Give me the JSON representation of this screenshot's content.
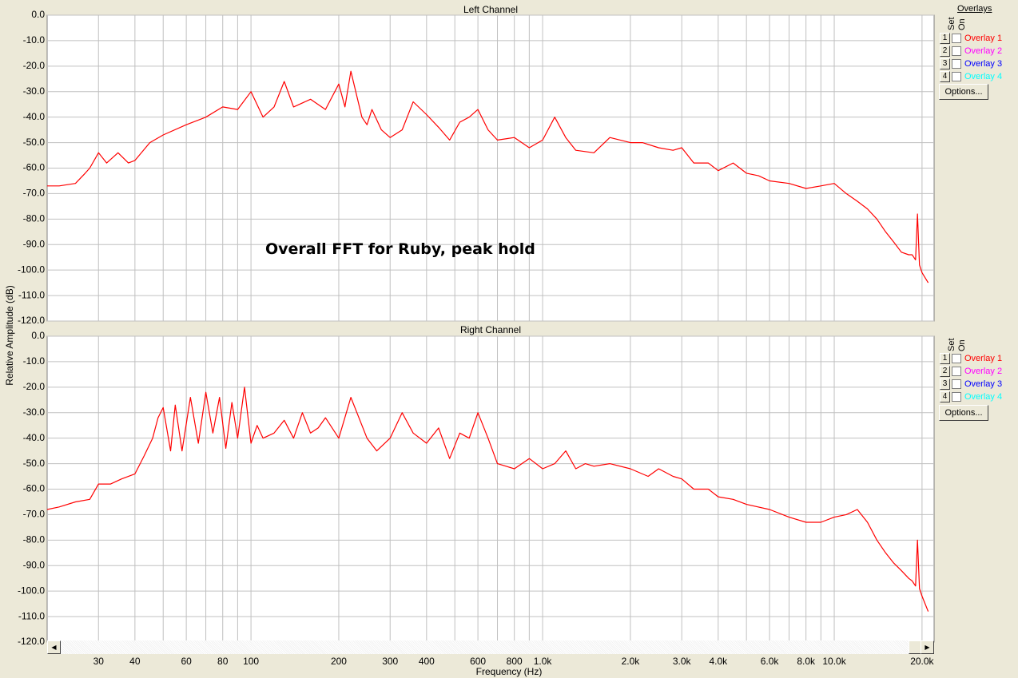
{
  "window": {
    "background": "#ECE9D8"
  },
  "annotation": "Overall FFT for Ruby, peak hold",
  "x_axis_label": "Frequency (Hz)",
  "y_axis_label": "Relative Amplitude (dB)",
  "overlays_panel": {
    "title": "Overlays",
    "set_header": "Set",
    "on_header": "On",
    "options_label": "Options...",
    "items": [
      {
        "set": "1",
        "label": "Overlay 1",
        "color": "#FF0000",
        "checked": false
      },
      {
        "set": "2",
        "label": "Overlay 2",
        "color": "#FF00FF",
        "checked": false
      },
      {
        "set": "3",
        "label": "Overlay 3",
        "color": "#0000FF",
        "checked": false
      },
      {
        "set": "4",
        "label": "Overlay 4",
        "color": "#00FFFF",
        "checked": false
      }
    ]
  },
  "chart_data": [
    {
      "type": "line",
      "title": "Left Channel",
      "xlabel": "",
      "ylabel": "",
      "x_scale": "log",
      "xlim": [
        20,
        22000
      ],
      "ylim": [
        -120,
        0
      ],
      "y_ticks": [
        "0.0",
        "-10.0",
        "-20.0",
        "-30.0",
        "-40.0",
        "-50.0",
        "-60.0",
        "-70.0",
        "-80.0",
        "-90.0",
        "-100.0",
        "-110.0",
        "-120.0"
      ],
      "grid": true,
      "line_color": "#FF0000",
      "series": [
        {
          "x": [
            20,
            22,
            25,
            27,
            28,
            30,
            32,
            35,
            38,
            40,
            45,
            50,
            60,
            70,
            80,
            90,
            100,
            110,
            120,
            130,
            140,
            160,
            180,
            200,
            210,
            220,
            240,
            250,
            260,
            280,
            300,
            330,
            360,
            400,
            440,
            480,
            520,
            560,
            600,
            650,
            700,
            800,
            900,
            1000,
            1100,
            1200,
            1300,
            1500,
            1700,
            2000,
            2200,
            2500,
            2800,
            3000,
            3300,
            3700,
            4000,
            4500,
            5000,
            5500,
            6000,
            7000,
            8000,
            9000,
            10000,
            11000,
            12000,
            13000,
            14000,
            15000,
            16000,
            17000,
            18000,
            18500,
            19000,
            19300,
            19600,
            20000,
            21000
          ],
          "y": [
            -67,
            -67,
            -66,
            -62,
            -60,
            -54,
            -58,
            -54,
            -58,
            -57,
            -50,
            -47,
            -43,
            -40,
            -36,
            -37,
            -30,
            -40,
            -36,
            -26,
            -36,
            -33,
            -37,
            -27,
            -36,
            -22,
            -40,
            -43,
            -37,
            -45,
            -48,
            -45,
            -34,
            -39,
            -44,
            -49,
            -42,
            -40,
            -37,
            -45,
            -49,
            -48,
            -52,
            -49,
            -40,
            -48,
            -53,
            -54,
            -48,
            -50,
            -50,
            -52,
            -53,
            -52,
            -58,
            -58,
            -61,
            -58,
            -62,
            -63,
            -65,
            -66,
            -68,
            -67,
            -66,
            -70,
            -73,
            -76,
            -80,
            -85,
            -89,
            -93,
            -94,
            -94,
            -96,
            -78,
            -98,
            -101,
            -105
          ]
        }
      ]
    },
    {
      "type": "line",
      "title": "Right Channel",
      "xlabel": "",
      "ylabel": "",
      "x_scale": "log",
      "xlim": [
        20,
        22000
      ],
      "ylim": [
        -120,
        0
      ],
      "y_ticks": [
        "0.0",
        "-10.0",
        "-20.0",
        "-30.0",
        "-40.0",
        "-50.0",
        "-60.0",
        "-70.0",
        "-80.0",
        "-90.0",
        "-100.0",
        "-110.0",
        "-120.0"
      ],
      "x_ticks": [
        "30",
        "40",
        "60",
        "80",
        "100",
        "200",
        "300",
        "400",
        "600",
        "800",
        "1.0k",
        "2.0k",
        "3.0k",
        "4.0k",
        "6.0k",
        "8.0k",
        "10.0k",
        "20.0k"
      ],
      "grid": true,
      "line_color": "#FF0000",
      "series": [
        {
          "x": [
            20,
            22,
            25,
            28,
            30,
            33,
            36,
            40,
            43,
            46,
            48,
            50,
            53,
            55,
            58,
            62,
            66,
            70,
            74,
            78,
            82,
            86,
            90,
            95,
            100,
            105,
            110,
            120,
            130,
            140,
            150,
            160,
            170,
            180,
            200,
            220,
            250,
            270,
            300,
            330,
            360,
            400,
            440,
            480,
            520,
            560,
            600,
            650,
            700,
            800,
            900,
            1000,
            1100,
            1200,
            1300,
            1400,
            1500,
            1700,
            2000,
            2300,
            2500,
            2800,
            3000,
            3300,
            3700,
            4000,
            4500,
            5000,
            6000,
            7000,
            8000,
            9000,
            10000,
            11000,
            12000,
            13000,
            14000,
            15000,
            16000,
            17000,
            18000,
            18500,
            19000,
            19300,
            19600,
            20000,
            21000
          ],
          "y": [
            -68,
            -67,
            -65,
            -64,
            -58,
            -58,
            -56,
            -54,
            -47,
            -40,
            -32,
            -28,
            -45,
            -27,
            -45,
            -24,
            -42,
            -22,
            -38,
            -24,
            -44,
            -26,
            -40,
            -20,
            -42,
            -35,
            -40,
            -38,
            -33,
            -40,
            -30,
            -38,
            -36,
            -32,
            -40,
            -24,
            -40,
            -45,
            -40,
            -30,
            -38,
            -42,
            -36,
            -48,
            -38,
            -40,
            -30,
            -40,
            -50,
            -52,
            -48,
            -52,
            -50,
            -45,
            -52,
            -50,
            -51,
            -50,
            -52,
            -55,
            -52,
            -55,
            -56,
            -60,
            -60,
            -63,
            -64,
            -66,
            -68,
            -71,
            -73,
            -73,
            -71,
            -70,
            -68,
            -73,
            -80,
            -85,
            -89,
            -92,
            -95,
            -96,
            -98,
            -80,
            -99,
            -102,
            -108
          ]
        }
      ]
    }
  ]
}
